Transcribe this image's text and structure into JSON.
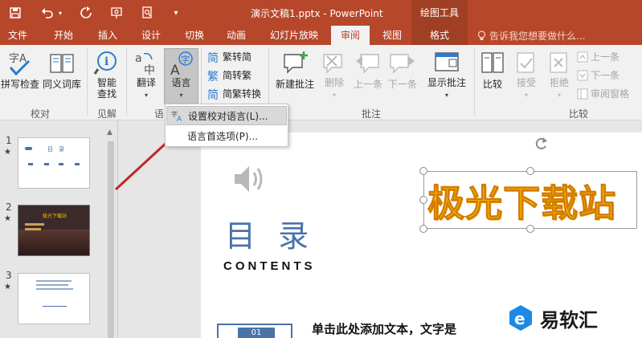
{
  "titlebar": {
    "doc_title": "演示文稿1.pptx - PowerPoint",
    "context_title": "绘图工具"
  },
  "tabs": [
    {
      "label": "文件"
    },
    {
      "label": "开始"
    },
    {
      "label": "插入"
    },
    {
      "label": "设计"
    },
    {
      "label": "切换"
    },
    {
      "label": "动画"
    },
    {
      "label": "幻灯片放映"
    },
    {
      "label": "审阅"
    },
    {
      "label": "视图"
    },
    {
      "label": "格式"
    }
  ],
  "tellme": {
    "label": "告诉我您想要做什么..."
  },
  "ribbon": {
    "spelling": "拼写检查",
    "thesaurus": "同义词库",
    "smart_lookup_1": "智能",
    "smart_lookup_2": "查找",
    "translate": "翻译",
    "language": "语言",
    "trad_to_simp": "繁转简",
    "simp_to_trad": "简转繁",
    "convert": "简繁转换",
    "new_comment": "新建批注",
    "delete": "删除",
    "previous": "上一条",
    "next": "下一条",
    "show_comments": "显示批注",
    "compare": "比较",
    "accept": "接受",
    "reject": "拒绝",
    "prev_change": "上一条",
    "next_change": "下一条",
    "review_pane": "审阅窗格",
    "groups": {
      "proofing": "校对",
      "insights": "见解",
      "language": "语",
      "comments": "批注",
      "compare": "比较"
    }
  },
  "dropdown": {
    "set_proofing_language": "设置校对语言(L)...",
    "language_preferences": "语言首选项(P)..."
  },
  "thumbnails": [
    {
      "number": "1",
      "star": "★",
      "title": "目　录"
    },
    {
      "number": "2",
      "star": "★",
      "title": "极光下载站"
    },
    {
      "number": "3",
      "star": "★"
    }
  ],
  "slide": {
    "heading": "目 录",
    "subheading": "CONTENTS",
    "wordart": "极光下载站",
    "badge_number": "01",
    "body_text": "单击此处添加文本，文字是"
  },
  "watermark": {
    "text": "易软汇"
  },
  "colors": {
    "accent": "#b7472a",
    "heading_blue": "#4a73a8",
    "wordart_fill": "#f2c200",
    "arrow_red": "#c0272d"
  }
}
